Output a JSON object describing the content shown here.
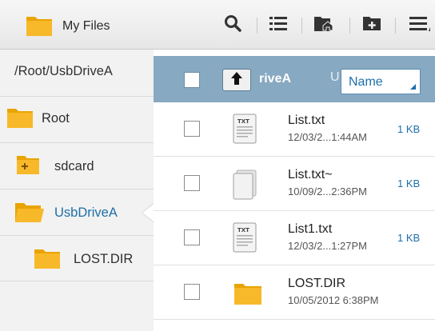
{
  "app": {
    "title": "My Files",
    "icon": "folder-icon"
  },
  "toolbar": {
    "actions": [
      {
        "name": "search",
        "icon": "search-icon"
      },
      {
        "name": "list-view",
        "icon": "list-view-icon"
      },
      {
        "name": "home-folder",
        "icon": "home-folder-icon"
      },
      {
        "name": "new-folder",
        "icon": "new-folder-icon"
      },
      {
        "name": "more",
        "icon": "more-menu-icon"
      }
    ]
  },
  "sidebar": {
    "path": "/Root/UsbDriveA",
    "items": [
      {
        "label": "Root",
        "icon": "folder-icon"
      },
      {
        "label": "sdcard",
        "icon": "sdcard-folder-icon"
      },
      {
        "label": "UsbDriveA",
        "icon": "usb-folder-icon",
        "selected": true
      },
      {
        "label": "LOST.DIR",
        "icon": "folder-icon"
      }
    ]
  },
  "list_header": {
    "path_label": "riveA",
    "path_fragment": "U",
    "sort": {
      "selected": "Name"
    }
  },
  "files": [
    {
      "name": "List.txt",
      "date": "12/03/2...1:44AM",
      "size": "1 KB",
      "icon": "txt-file-icon"
    },
    {
      "name": "List.txt~",
      "date": "10/09/2...2:36PM",
      "size": "1 KB",
      "icon": "generic-file-icon"
    },
    {
      "name": "List1.txt",
      "date": "12/03/2...1:27PM",
      "size": "1 KB",
      "icon": "txt-file-icon"
    },
    {
      "name": "LOST.DIR",
      "date": "10/05/2012 6:38PM",
      "size": "",
      "icon": "folder-icon"
    }
  ],
  "colors": {
    "accent": "#1e6fa8",
    "header_bar": "#87a9c1",
    "folder": "#f5b51b"
  }
}
